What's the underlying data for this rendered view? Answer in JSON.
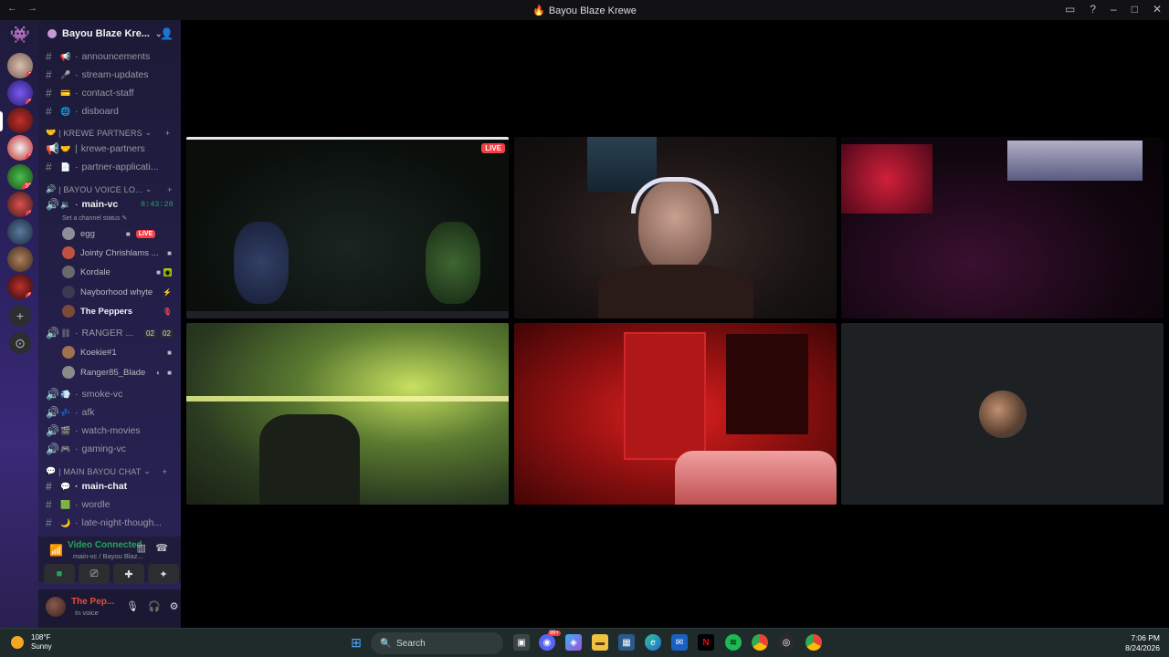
{
  "window": {
    "title": "Bayou Blaze Krewe",
    "back": "←",
    "forward": "→",
    "controls": [
      "▭",
      "?",
      "–",
      "□",
      "✕"
    ]
  },
  "server": {
    "name": "Bayou Blaze Kre...",
    "channels_top": [
      {
        "name": "announcements",
        "emoji": "📢"
      },
      {
        "name": "stream-updates",
        "emoji": "🎤"
      },
      {
        "name": "contact-staff",
        "emoji": "💳"
      },
      {
        "name": "disboard",
        "emoji": "🌐"
      }
    ],
    "category_partners": "KREWE PARTNERS",
    "partner_channels": [
      {
        "name": "krewe-partners",
        "emoji": "🤝"
      },
      {
        "name": "partner-applicati...",
        "emoji": "📄"
      }
    ],
    "category_voice": "BAYOU VOICE LO...",
    "voice_main": {
      "name": "main-vc",
      "timer": "8:43:28",
      "status": "Set a channel status"
    },
    "voice_users": [
      {
        "name": "egg",
        "live": "LIVE"
      },
      {
        "name": "Jointy Chrishlams ..."
      },
      {
        "name": "Kordale"
      },
      {
        "name": "Nayborhood whyte"
      },
      {
        "name": "The Peppers"
      }
    ],
    "ranger_channel": {
      "name": "RANGER ...",
      "count_a": "02",
      "count_b": "02"
    },
    "ranger_users": [
      {
        "name": "Koekie#1"
      },
      {
        "name": "Ranger85_Blade"
      }
    ],
    "voice_channels": [
      {
        "name": "smoke-vc"
      },
      {
        "name": "afk"
      },
      {
        "name": "watch-movies"
      },
      {
        "name": "gaming-vc"
      }
    ],
    "category_chat": "MAIN BAYOU CHAT",
    "chat_channels": [
      {
        "name": "main-chat",
        "emoji": "💬"
      },
      {
        "name": "wordle",
        "emoji": "🟩"
      },
      {
        "name": "late-night-though...",
        "emoji": "🌙"
      }
    ]
  },
  "rail": {
    "badges": [
      "1",
      "2",
      "2",
      "33",
      "4",
      "6",
      "5"
    ]
  },
  "voice_panel": {
    "title": "Video Connected",
    "subtitle": "main-vc / Bayou Blaz..."
  },
  "user_panel": {
    "name": "The Pep...",
    "status": "In voice"
  },
  "stream": {
    "live_label": "LIVE"
  },
  "taskbar": {
    "temp": "108°F",
    "condition": "Sunny",
    "search_placeholder": "Search",
    "time": "7:06 PM",
    "date": "8/24/2026",
    "notif_badge": "99+"
  }
}
